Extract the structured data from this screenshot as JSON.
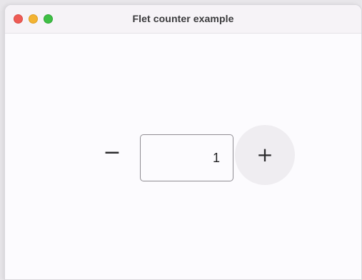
{
  "window": {
    "title": "Flet counter example"
  },
  "counter": {
    "value": "1"
  },
  "icons": {
    "close": "close-window-icon",
    "minimize": "minimize-window-icon",
    "zoom": "zoom-window-icon",
    "minus": "minus-icon",
    "plus": "plus-icon"
  },
  "colors": {
    "close": "#ee5b55",
    "minimize": "#f3b332",
    "zoom": "#3fbf45",
    "plus_button_bg": "#efedf1",
    "window_bg": "#fcfbfe"
  }
}
